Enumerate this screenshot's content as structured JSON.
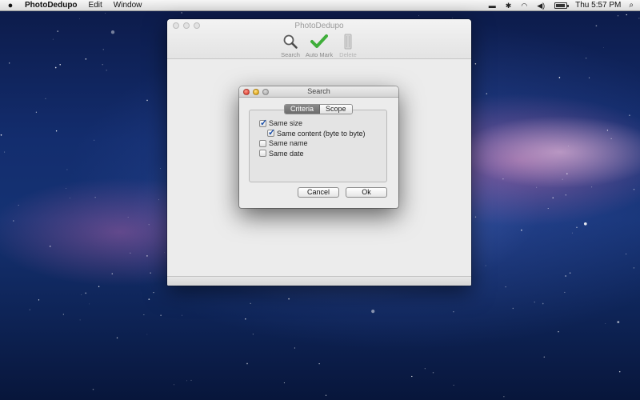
{
  "menubar": {
    "apple_icon": "apple-logo",
    "app_name": "PhotoDedupo",
    "menus": [
      "Edit",
      "Window"
    ],
    "clock": "Thu 5:57 PM"
  },
  "main_window": {
    "title": "PhotoDedupo",
    "toolbar": [
      {
        "label": "Search",
        "icon": "magnifier-icon",
        "enabled": true
      },
      {
        "label": "Auto Mark",
        "icon": "checkmark-icon",
        "enabled": true
      },
      {
        "label": "Delete",
        "icon": "trash-icon",
        "enabled": false
      }
    ]
  },
  "dialog": {
    "title": "Search",
    "tabs": [
      {
        "label": "Criteria",
        "selected": true
      },
      {
        "label": "Scope",
        "selected": false
      }
    ],
    "options": [
      {
        "label": "Same size",
        "checked": true
      },
      {
        "label": "Same content (byte to byte)",
        "checked": true
      },
      {
        "label": "Same name",
        "checked": false
      },
      {
        "label": "Same date",
        "checked": false
      }
    ],
    "cancel_label": "Cancel",
    "ok_label": "Ok"
  },
  "colors": {
    "check_blue": "#1b4fa8",
    "automark_green": "#3fae3a",
    "close_red": "#e0483a",
    "minimize_yellow": "#e1a81c"
  }
}
